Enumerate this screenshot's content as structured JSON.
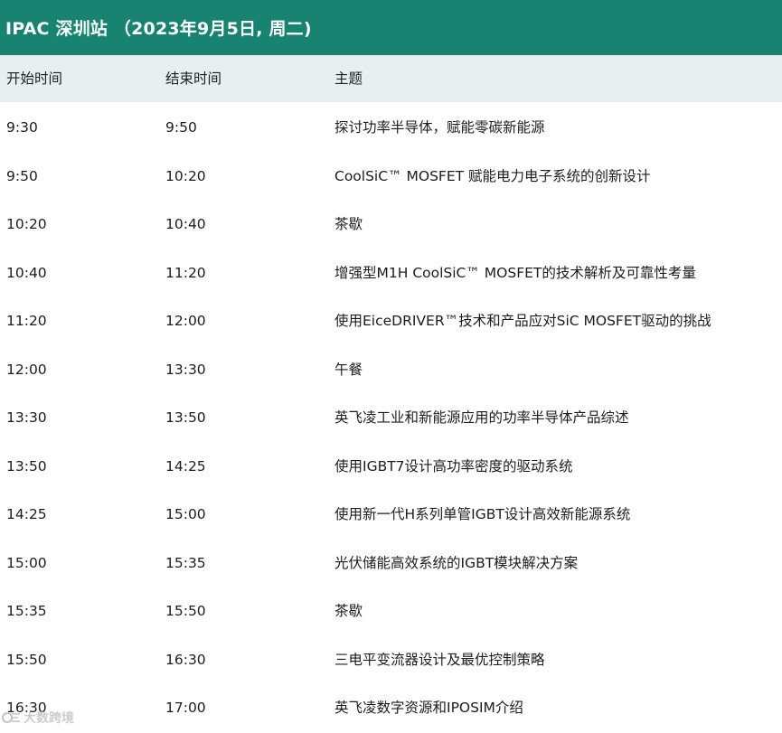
{
  "title": "IPAC 深圳站 （2023年9月5日, 周二)",
  "header": {
    "start": "开始时间",
    "end": "结束时间",
    "topic": "主题"
  },
  "rows": [
    {
      "start": "9:30",
      "end": "9:50",
      "topic": "探讨功率半导体，赋能零碳新能源"
    },
    {
      "start": "9:50",
      "end": "10:20",
      "topic": "CoolSiC™ MOSFET 赋能电力电子系统的创新设计"
    },
    {
      "start": "10:20",
      "end": "10:40",
      "topic": "茶歇"
    },
    {
      "start": "10:40",
      "end": "11:20",
      "topic": "增强型M1H CoolSiC™ MOSFET的技术解析及可靠性考量"
    },
    {
      "start": "11:20",
      "end": "12:00",
      "topic": "使用EiceDRIVER™技术和产品应对SiC MOSFET驱动的挑战"
    },
    {
      "start": "12:00",
      "end": "13:30",
      "topic": "午餐"
    },
    {
      "start": "13:30",
      "end": "13:50",
      "topic": "英飞凌工业和新能源应用的功率半导体产品综述"
    },
    {
      "start": "13:50",
      "end": "14:25",
      "topic": "使用IGBT7设计高功率密度的驱动系统"
    },
    {
      "start": "14:25",
      "end": "15:00",
      "topic": "使用新一代H系列单管IGBT设计高效新能源系统"
    },
    {
      "start": "15:00",
      "end": "15:35",
      "topic": "光伏储能高效系统的IGBT模块解决方案"
    },
    {
      "start": "15:35",
      "end": "15:50",
      "topic": "茶歇"
    },
    {
      "start": "15:50",
      "end": "16:30",
      "topic": "三电平变流器设计及最优控制策略"
    },
    {
      "start": "16:30",
      "end": "17:00",
      "topic": "英飞凌数字资源和IPOSIM介绍"
    }
  ],
  "watermark": {
    "text": "大数跨境",
    "icon": "watermark-logo-icon"
  },
  "colors": {
    "title_bg": "#178370",
    "header_bg": "#e7f0ee"
  }
}
